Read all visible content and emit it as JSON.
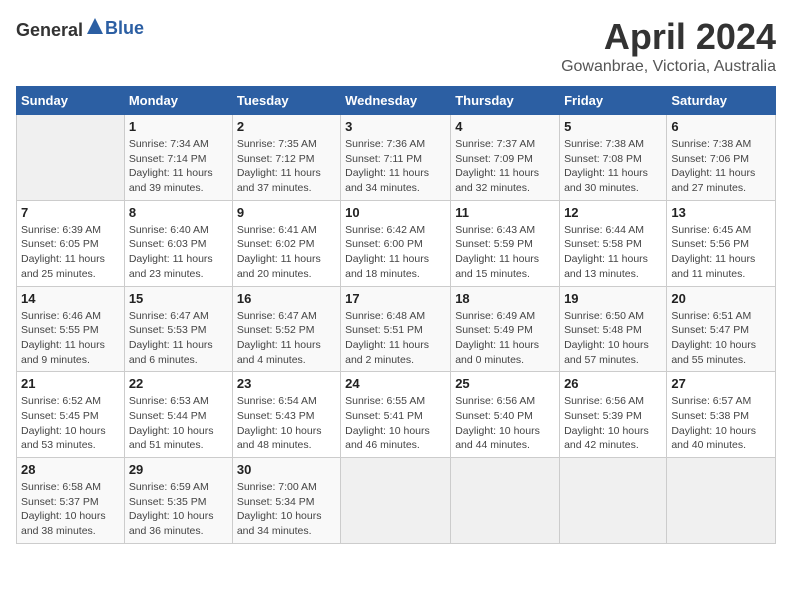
{
  "header": {
    "logo_general": "General",
    "logo_blue": "Blue",
    "month_year": "April 2024",
    "location": "Gowanbrae, Victoria, Australia"
  },
  "weekdays": [
    "Sunday",
    "Monday",
    "Tuesday",
    "Wednesday",
    "Thursday",
    "Friday",
    "Saturday"
  ],
  "weeks": [
    [
      {
        "day": "",
        "empty": true
      },
      {
        "day": "1",
        "sunrise": "Sunrise: 7:34 AM",
        "sunset": "Sunset: 7:14 PM",
        "daylight": "Daylight: 11 hours and 39 minutes."
      },
      {
        "day": "2",
        "sunrise": "Sunrise: 7:35 AM",
        "sunset": "Sunset: 7:12 PM",
        "daylight": "Daylight: 11 hours and 37 minutes."
      },
      {
        "day": "3",
        "sunrise": "Sunrise: 7:36 AM",
        "sunset": "Sunset: 7:11 PM",
        "daylight": "Daylight: 11 hours and 34 minutes."
      },
      {
        "day": "4",
        "sunrise": "Sunrise: 7:37 AM",
        "sunset": "Sunset: 7:09 PM",
        "daylight": "Daylight: 11 hours and 32 minutes."
      },
      {
        "day": "5",
        "sunrise": "Sunrise: 7:38 AM",
        "sunset": "Sunset: 7:08 PM",
        "daylight": "Daylight: 11 hours and 30 minutes."
      },
      {
        "day": "6",
        "sunrise": "Sunrise: 7:38 AM",
        "sunset": "Sunset: 7:06 PM",
        "daylight": "Daylight: 11 hours and 27 minutes."
      }
    ],
    [
      {
        "day": "7",
        "sunrise": "Sunrise: 6:39 AM",
        "sunset": "Sunset: 6:05 PM",
        "daylight": "Daylight: 11 hours and 25 minutes."
      },
      {
        "day": "8",
        "sunrise": "Sunrise: 6:40 AM",
        "sunset": "Sunset: 6:03 PM",
        "daylight": "Daylight: 11 hours and 23 minutes."
      },
      {
        "day": "9",
        "sunrise": "Sunrise: 6:41 AM",
        "sunset": "Sunset: 6:02 PM",
        "daylight": "Daylight: 11 hours and 20 minutes."
      },
      {
        "day": "10",
        "sunrise": "Sunrise: 6:42 AM",
        "sunset": "Sunset: 6:00 PM",
        "daylight": "Daylight: 11 hours and 18 minutes."
      },
      {
        "day": "11",
        "sunrise": "Sunrise: 6:43 AM",
        "sunset": "Sunset: 5:59 PM",
        "daylight": "Daylight: 11 hours and 15 minutes."
      },
      {
        "day": "12",
        "sunrise": "Sunrise: 6:44 AM",
        "sunset": "Sunset: 5:58 PM",
        "daylight": "Daylight: 11 hours and 13 minutes."
      },
      {
        "day": "13",
        "sunrise": "Sunrise: 6:45 AM",
        "sunset": "Sunset: 5:56 PM",
        "daylight": "Daylight: 11 hours and 11 minutes."
      }
    ],
    [
      {
        "day": "14",
        "sunrise": "Sunrise: 6:46 AM",
        "sunset": "Sunset: 5:55 PM",
        "daylight": "Daylight: 11 hours and 9 minutes."
      },
      {
        "day": "15",
        "sunrise": "Sunrise: 6:47 AM",
        "sunset": "Sunset: 5:53 PM",
        "daylight": "Daylight: 11 hours and 6 minutes."
      },
      {
        "day": "16",
        "sunrise": "Sunrise: 6:47 AM",
        "sunset": "Sunset: 5:52 PM",
        "daylight": "Daylight: 11 hours and 4 minutes."
      },
      {
        "day": "17",
        "sunrise": "Sunrise: 6:48 AM",
        "sunset": "Sunset: 5:51 PM",
        "daylight": "Daylight: 11 hours and 2 minutes."
      },
      {
        "day": "18",
        "sunrise": "Sunrise: 6:49 AM",
        "sunset": "Sunset: 5:49 PM",
        "daylight": "Daylight: 11 hours and 0 minutes."
      },
      {
        "day": "19",
        "sunrise": "Sunrise: 6:50 AM",
        "sunset": "Sunset: 5:48 PM",
        "daylight": "Daylight: 10 hours and 57 minutes."
      },
      {
        "day": "20",
        "sunrise": "Sunrise: 6:51 AM",
        "sunset": "Sunset: 5:47 PM",
        "daylight": "Daylight: 10 hours and 55 minutes."
      }
    ],
    [
      {
        "day": "21",
        "sunrise": "Sunrise: 6:52 AM",
        "sunset": "Sunset: 5:45 PM",
        "daylight": "Daylight: 10 hours and 53 minutes."
      },
      {
        "day": "22",
        "sunrise": "Sunrise: 6:53 AM",
        "sunset": "Sunset: 5:44 PM",
        "daylight": "Daylight: 10 hours and 51 minutes."
      },
      {
        "day": "23",
        "sunrise": "Sunrise: 6:54 AM",
        "sunset": "Sunset: 5:43 PM",
        "daylight": "Daylight: 10 hours and 48 minutes."
      },
      {
        "day": "24",
        "sunrise": "Sunrise: 6:55 AM",
        "sunset": "Sunset: 5:41 PM",
        "daylight": "Daylight: 10 hours and 46 minutes."
      },
      {
        "day": "25",
        "sunrise": "Sunrise: 6:56 AM",
        "sunset": "Sunset: 5:40 PM",
        "daylight": "Daylight: 10 hours and 44 minutes."
      },
      {
        "day": "26",
        "sunrise": "Sunrise: 6:56 AM",
        "sunset": "Sunset: 5:39 PM",
        "daylight": "Daylight: 10 hours and 42 minutes."
      },
      {
        "day": "27",
        "sunrise": "Sunrise: 6:57 AM",
        "sunset": "Sunset: 5:38 PM",
        "daylight": "Daylight: 10 hours and 40 minutes."
      }
    ],
    [
      {
        "day": "28",
        "sunrise": "Sunrise: 6:58 AM",
        "sunset": "Sunset: 5:37 PM",
        "daylight": "Daylight: 10 hours and 38 minutes."
      },
      {
        "day": "29",
        "sunrise": "Sunrise: 6:59 AM",
        "sunset": "Sunset: 5:35 PM",
        "daylight": "Daylight: 10 hours and 36 minutes."
      },
      {
        "day": "30",
        "sunrise": "Sunrise: 7:00 AM",
        "sunset": "Sunset: 5:34 PM",
        "daylight": "Daylight: 10 hours and 34 minutes."
      },
      {
        "day": "",
        "empty": true
      },
      {
        "day": "",
        "empty": true
      },
      {
        "day": "",
        "empty": true
      },
      {
        "day": "",
        "empty": true
      }
    ]
  ]
}
